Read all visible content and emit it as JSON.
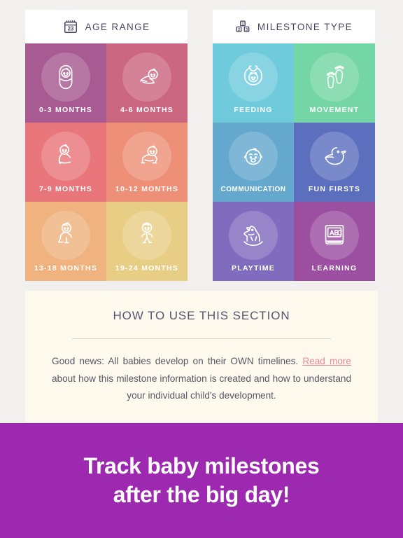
{
  "age_panel": {
    "icon": "calendar-icon",
    "icon_day": "23",
    "title": "AGE RANGE",
    "tiles": [
      {
        "label": "0-3 MONTHS",
        "icon": "swaddled-baby-icon",
        "color": "#a85a92"
      },
      {
        "label": "4-6 MONTHS",
        "icon": "tummy-time-baby-icon",
        "color": "#cc6782"
      },
      {
        "label": "7-9 MONTHS",
        "icon": "sitting-baby-icon",
        "color": "#e8767b"
      },
      {
        "label": "10-12 MONTHS",
        "icon": "crawling-baby-icon",
        "color": "#ee9077"
      },
      {
        "label": "13-18 MONTHS",
        "icon": "toddling-baby-icon",
        "color": "#f0b27e"
      },
      {
        "label": "19-24 MONTHS",
        "icon": "running-toddler-icon",
        "color": "#e8ce85"
      }
    ]
  },
  "milestone_panel": {
    "icon": "building-blocks-icon",
    "icon_numbers": [
      "1",
      "2",
      "3"
    ],
    "title": "MILESTONE TYPE",
    "tiles": [
      {
        "label": "FEEDING",
        "icon": "bib-icon",
        "color": "#6fcbdc"
      },
      {
        "label": "MOVEMENT",
        "icon": "footprints-icon",
        "color": "#74d6a4"
      },
      {
        "label": "COMMUNICATION",
        "icon": "baby-face-icon",
        "color": "#64a8ce"
      },
      {
        "label": "FUN FIRSTS",
        "icon": "rubber-duck-icon",
        "color": "#5c6fbe"
      },
      {
        "label": "PLAYTIME",
        "icon": "rocking-horse-icon",
        "color": "#7f6cbe"
      },
      {
        "label": "LEARNING",
        "icon": "abc-book-icon",
        "color": "#9c4fa0"
      }
    ]
  },
  "info_card": {
    "title": "HOW TO USE THIS SECTION",
    "body_before": "Good news: All babies develop on their OWN timelines.",
    "link_text": "Read more",
    "body_after": "about how this milestone information is created and how to understand your individual child's development.",
    "link_color": "#e8899d"
  },
  "banner": {
    "line1": "Track baby milestones",
    "line2": "after the big day!",
    "background": "#9c29b0"
  }
}
